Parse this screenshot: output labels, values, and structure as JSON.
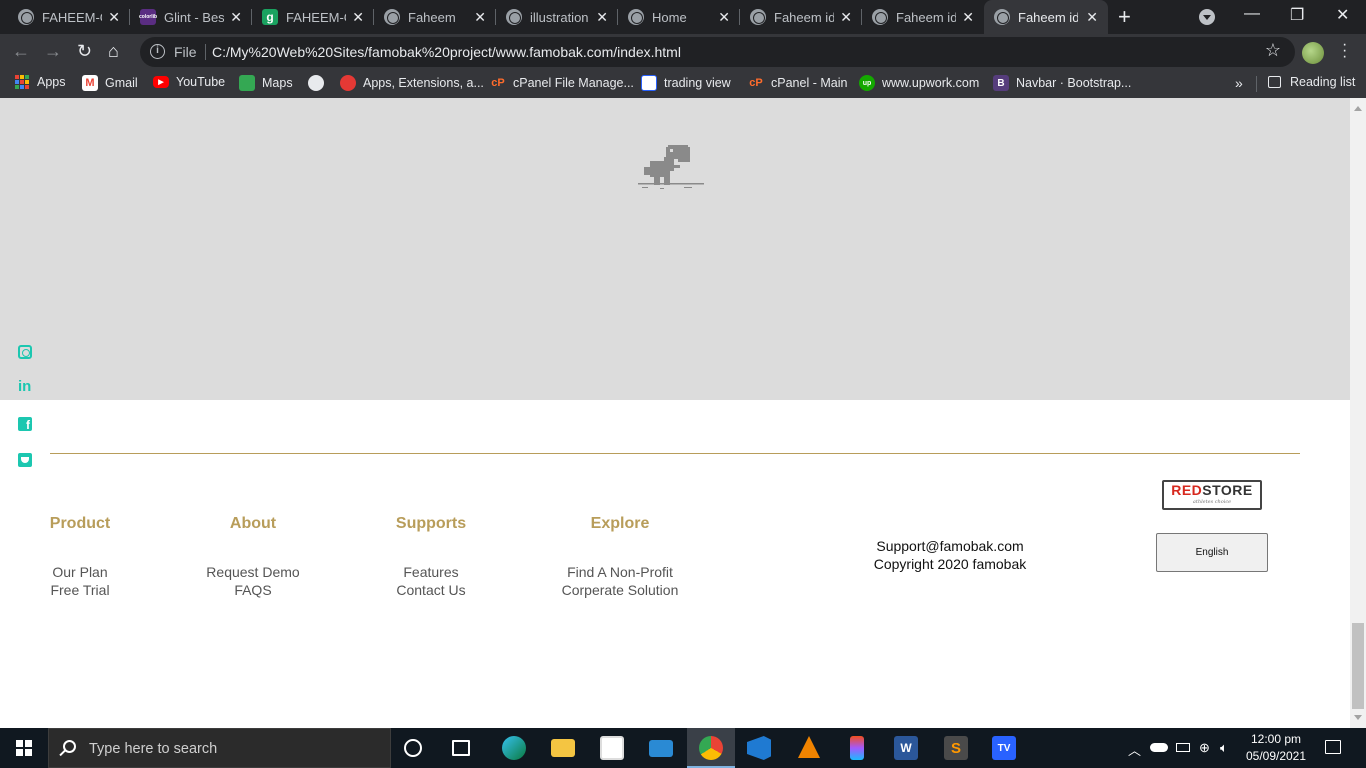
{
  "browser": {
    "tabs": [
      {
        "title": "FAHEEM-G",
        "favicon": "globe-icon"
      },
      {
        "title": "Glint - Best",
        "favicon": "colorlib-icon"
      },
      {
        "title": "FAHEEM-G",
        "favicon": "g-icon"
      },
      {
        "title": "Faheem",
        "favicon": "globe-icon"
      },
      {
        "title": "illustration",
        "favicon": "globe-icon"
      },
      {
        "title": "Home",
        "favicon": "globe-icon"
      },
      {
        "title": "Faheem ide",
        "favicon": "globe-icon"
      },
      {
        "title": "Faheem ide",
        "favicon": "globe-icon"
      },
      {
        "title": "Faheem ide",
        "favicon": "globe-icon",
        "active": true
      }
    ],
    "colorlib_badge": "colorlib",
    "g_badge": "g",
    "address": {
      "scheme_label": "File",
      "url": "C:/My%20Web%20Sites/famobak%20project/www.famobak.com/index.html"
    },
    "bookmarks": [
      {
        "label": "Apps",
        "icon": "apps-grid-icon"
      },
      {
        "label": "Gmail",
        "icon": "gmail-icon"
      },
      {
        "label": "YouTube",
        "icon": "youtube-icon"
      },
      {
        "label": "Maps",
        "icon": "maps-icon"
      },
      {
        "label": "",
        "icon": "globe-icon"
      },
      {
        "label": "Apps, Extensions, a...",
        "icon": "extensions-icon"
      },
      {
        "label": "cPanel File Manage...",
        "icon": "cpanel-icon"
      },
      {
        "label": "trading view",
        "icon": "tradingview-icon"
      },
      {
        "label": "cPanel - Main",
        "icon": "cpanel-icon"
      },
      {
        "label": "www.upwork.com",
        "icon": "upwork-icon"
      },
      {
        "label": "Navbar · Bootstrap...",
        "icon": "bootstrap-icon"
      }
    ],
    "bookmark_badges": {
      "upwork": "up",
      "bootstrap": "B",
      "cpanel": "cP"
    },
    "reading_list": "Reading list"
  },
  "page": {
    "footer": {
      "columns": [
        {
          "heading": "Product",
          "links": [
            "Our Plan",
            "Free Trial"
          ]
        },
        {
          "heading": "About",
          "links": [
            "Request Demo",
            "FAQS"
          ]
        },
        {
          "heading": "Supports",
          "links": [
            "Features",
            "Contact Us"
          ]
        },
        {
          "heading": "Explore",
          "links": [
            "Find A Non-Profit",
            "Corperate Solution"
          ]
        }
      ],
      "contact": {
        "email": "Support@famobak.com",
        "copyright": "Copyright 2020 famobak"
      },
      "logo": {
        "red_part": "RED",
        "dark_part": "STORE",
        "tagline": "athletes choice"
      },
      "language_button": "English"
    },
    "social_icons": [
      "instagram-icon",
      "linkedin-icon",
      "facebook-icon",
      "twitter-icon"
    ],
    "colors": {
      "accent": "#b89d5a",
      "social": "#1cc7b0",
      "placeholder_bg": "#dcdcdc"
    }
  },
  "taskbar": {
    "search_placeholder": "Type here to search",
    "apps": [
      "cortana-icon",
      "task-view-icon",
      "edge-icon",
      "file-explorer-icon",
      "store-icon",
      "mail-icon",
      "chrome-icon",
      "vscode-icon",
      "vlc-icon",
      "figma-icon",
      "word-icon",
      "sublime-icon",
      "tradingview-icon"
    ],
    "app_badges": {
      "word": "W",
      "sublime": "S",
      "tradingview": "TV"
    },
    "clock": {
      "time": "12:00 pm",
      "date": "05/09/2021"
    }
  }
}
